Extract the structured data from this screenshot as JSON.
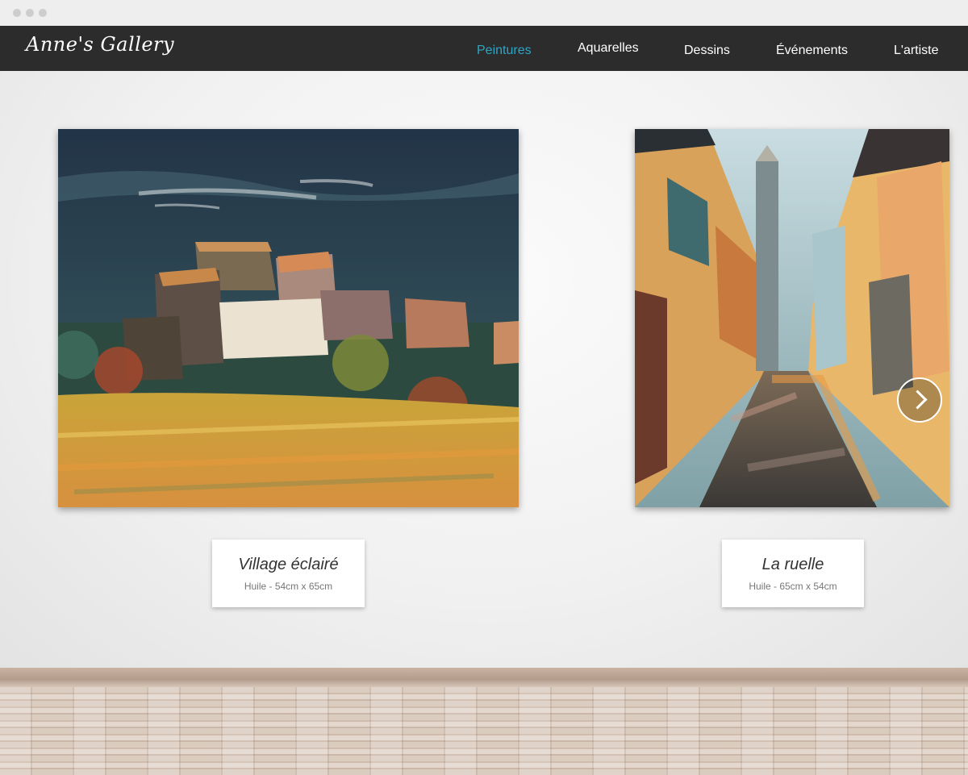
{
  "header": {
    "logo": "Anne's Gallery",
    "nav": [
      {
        "label": "Peintures",
        "active": true
      },
      {
        "label": "Aquarelles",
        "active": false
      },
      {
        "label": "Dessins",
        "active": false
      },
      {
        "label": "Événements",
        "active": false
      },
      {
        "label": "L'artiste",
        "active": false
      }
    ]
  },
  "gallery": {
    "artworks": [
      {
        "title": "Village éclairé",
        "details": "Huile - 54cm x 65cm"
      },
      {
        "title": "La ruelle",
        "details": "Huile - 65cm x 54cm"
      }
    ],
    "next_icon": "chevron-right-icon"
  },
  "colors": {
    "navbar": "#2c2c2c",
    "nav_active": "#2ca6c6",
    "nav_text": "#ffffff"
  }
}
